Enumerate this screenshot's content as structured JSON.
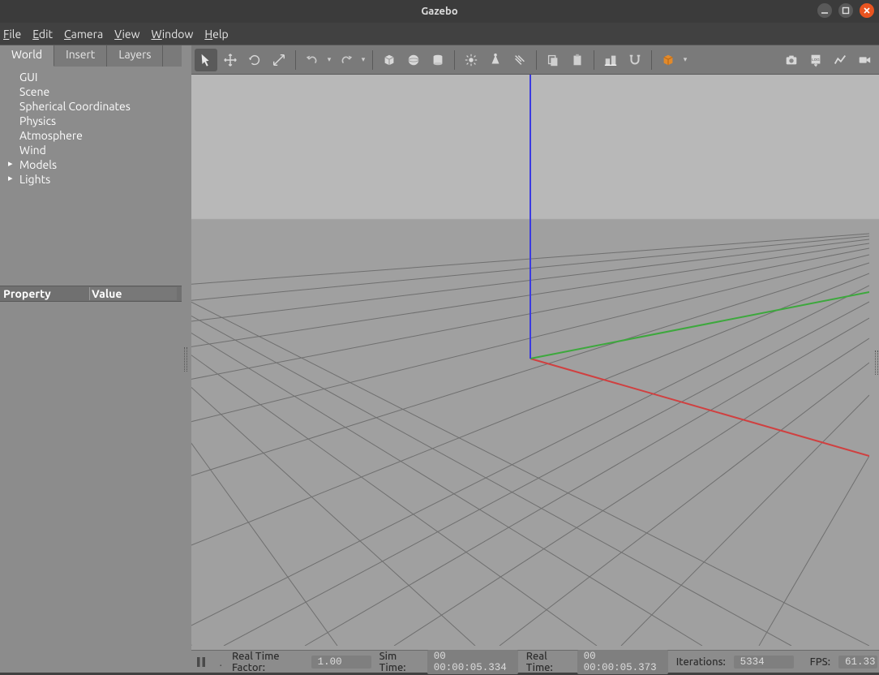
{
  "window": {
    "title": "Gazebo"
  },
  "menu": {
    "file": "File",
    "edit": "Edit",
    "camera": "Camera",
    "view": "View",
    "window": "Window",
    "help": "Help"
  },
  "sidebar": {
    "tabs": {
      "world": "World",
      "insert": "Insert",
      "layers": "Layers"
    },
    "tree": [
      {
        "label": "GUI",
        "children": false
      },
      {
        "label": "Scene",
        "children": false
      },
      {
        "label": "Spherical Coordinates",
        "children": false
      },
      {
        "label": "Physics",
        "children": false
      },
      {
        "label": "Atmosphere",
        "children": false
      },
      {
        "label": "Wind",
        "children": false
      },
      {
        "label": "Models",
        "children": true
      },
      {
        "label": "Lights",
        "children": true
      }
    ],
    "prop_header": {
      "property": "Property",
      "value": "Value"
    }
  },
  "toolbar_icons": {
    "select": "select-arrow-icon",
    "move": "move-icon",
    "rotate": "rotate-icon",
    "scale": "scale-icon",
    "undo": "undo-icon",
    "redo": "redo-icon",
    "box": "box-icon",
    "sphere": "sphere-icon",
    "cylinder": "cylinder-icon",
    "light_point": "point-light-icon",
    "light_spot": "spot-light-icon",
    "light_dir": "directional-light-icon",
    "copy": "copy-icon",
    "paste": "paste-icon",
    "align": "align-icon",
    "snap": "snap-icon",
    "view": "view-angle-icon",
    "screenshot": "screenshot-icon",
    "log": "log-icon",
    "plot": "plot-icon",
    "record": "record-icon"
  },
  "status": {
    "rtf_label": "Real Time Factor:",
    "rtf_value": "1.00",
    "sim_label": "Sim Time:",
    "sim_value": "00 00:00:05.334",
    "real_label": "Real Time:",
    "real_value": "00 00:00:05.373",
    "iter_label": "Iterations:",
    "iter_value": "5334",
    "fps_label": "FPS:",
    "fps_value": "61.33"
  },
  "colors": {
    "accent": "#e95420",
    "axis_x": "#d04040",
    "axis_y": "#3da83d",
    "axis_z": "#3a3ae0"
  }
}
